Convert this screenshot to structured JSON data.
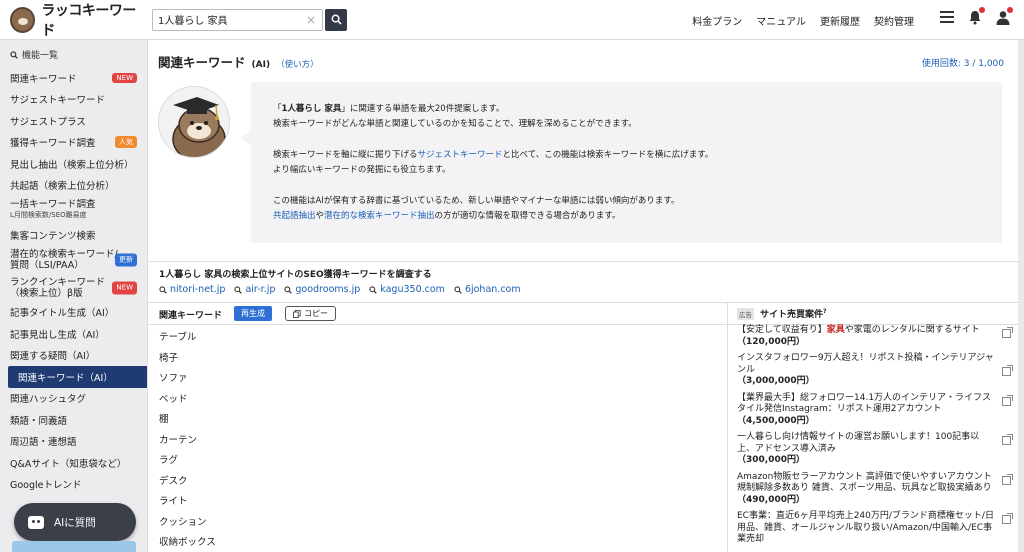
{
  "app": {
    "logo_text": "ラッコキーワード"
  },
  "search": {
    "value": "1人暮らし 家具",
    "clear_glyph": "×"
  },
  "header": {
    "nav": [
      "料金プラン",
      "マニュアル",
      "更新履歴",
      "契約管理"
    ]
  },
  "sidebar": {
    "heading": "機能一覧",
    "items": [
      {
        "label": "関連キーワード",
        "badge": "NEW",
        "badge_type": "new"
      },
      {
        "label": "サジェストキーワード"
      },
      {
        "label": "サジェストプラス"
      },
      {
        "label": "獲得キーワード調査",
        "badge": "人気",
        "badge_type": "pop"
      },
      {
        "label": "見出し抽出（検索上位分析）"
      },
      {
        "label": "共起語（検索上位分析）"
      },
      {
        "label": "一括キーワード調査",
        "sub": "L月間検索数/SEO難易度"
      },
      {
        "label": "集客コンテンツ検索"
      },
      {
        "label": "潜在的な検索キーワード/",
        "sub": "質問（LSI/PAA）",
        "badge": "更新",
        "badge_type": "upd"
      },
      {
        "label": "ランクインキーワード",
        "sub": "（検索上位）β版",
        "badge": "NEW",
        "badge_type": "new"
      },
      {
        "label": "記事タイトル生成（AI）"
      },
      {
        "label": "記事見出し生成（AI）"
      },
      {
        "label": "関連する疑問（AI）"
      },
      {
        "label": "関連キーワード（AI）",
        "active": true
      },
      {
        "label": "関連ハッシュタグ"
      },
      {
        "label": "類語・同義語"
      },
      {
        "label": "周辺語・連想語"
      },
      {
        "label": "Q&Aサイト（知恵袋など）"
      },
      {
        "label": "Googleトレンド"
      }
    ],
    "ai_button_label": "AIに質問"
  },
  "main": {
    "title": "関連キーワード",
    "title_tag": "(AI)",
    "help_link": "（使い方）",
    "usage": "使用回数: 3 / 1,000",
    "info": {
      "p1_pre": "「",
      "p1_query": "1人暮らし 家具",
      "p1_post": "」に関連する単語を最大20件提案します。",
      "p1_line2": "検索キーワードがどんな単語と関連しているのかを知ることで、理解を深めることができます。",
      "p2_pre": "検索キーワードを軸に縦に掘り下げる",
      "p2_link": "サジェストキーワード",
      "p2_post": "と比べて、この機能は検索キーワードを横に広げます。",
      "p2_line2": "より幅広いキーワードの発掘にも役立ちます。",
      "p3_line1": "この機能はAIが保有する辞書に基づいているため、新しい単語やマイナーな単語には弱い傾向があります。",
      "p3_link1": "共起語抽出",
      "p3_mid": "や",
      "p3_link2": "潜在的な検索キーワード抽出",
      "p3_post": "の方が適切な情報を取得できる場合があります。"
    },
    "seo_band": {
      "title": "1人暮らし 家具の検索上位サイトのSEO獲得キーワードを調査する",
      "sites": [
        "nitori-net.jp",
        "air-r.jp",
        "goodrooms.jp",
        "kagu350.com",
        "6johan.com"
      ]
    },
    "keywords": {
      "heading": "関連キーワード",
      "regen_label": "再生成",
      "copy_label": "コピー",
      "items": [
        "テーブル",
        "椅子",
        "ソファ",
        "ベッド",
        "棚",
        "カーテン",
        "ラグ",
        "デスク",
        "ライト",
        "クッション",
        "収納ボックス"
      ]
    },
    "ads": {
      "tag": "広告",
      "heading": "サイト売買案件",
      "help_glyph": "?",
      "items": [
        {
          "pre": "【安定して収益有り】",
          "hl": "家具",
          "post": "や家電のレンタルに関するサイト",
          "price": "（120,000円）"
        },
        {
          "pre": "インスタフォロワー9万人超え！リポスト投稿・インテリアジャンル",
          "hl": "",
          "post": "",
          "price": "（3,000,000円）"
        },
        {
          "pre": "【業界最大手】総フォロワー14.1万人のインテリア・ライフスタイル発信Instagram：リポスト運用2アカウント",
          "hl": "",
          "post": "",
          "price": "（4,500,000円）"
        },
        {
          "pre": "一人暮らし向け情報サイトの運営お願いします！100記事以上、アドセンス導入済み",
          "hl": "",
          "post": "",
          "price": "（300,000円）"
        },
        {
          "pre": "Amazon物販セラーアカウント 高評価で使いやすいアカウント 規制解除多数あり 雑貨、スポーツ用品、玩具など取扱実績あり",
          "hl": "",
          "post": "",
          "price": "（490,000円）"
        },
        {
          "pre": "EC事業：直近6ヶ月平均売上240万円/ブランド商標権セット/日用品、雑貨、オールジャンル取り扱い/Amazon/中国輸入/EC事業売却",
          "hl": "",
          "post": "",
          "price": ""
        }
      ]
    }
  }
}
